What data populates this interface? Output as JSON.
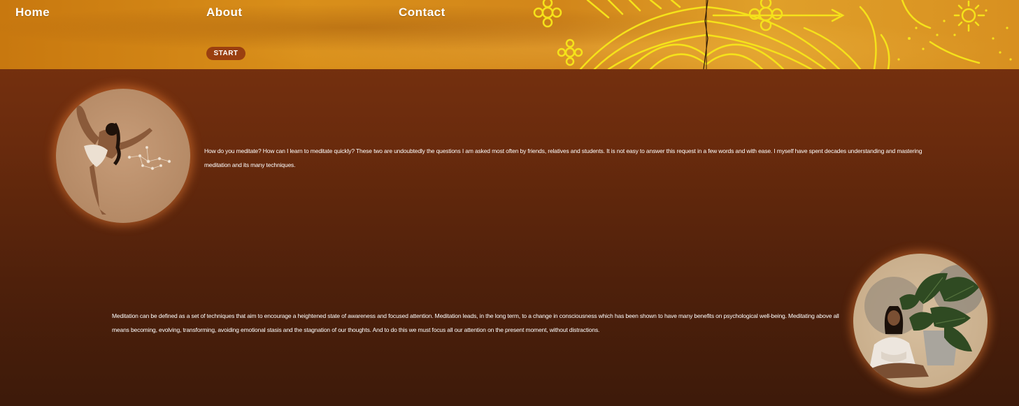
{
  "nav": {
    "home": "Home",
    "about": "About",
    "contact": "Contact"
  },
  "hero": {
    "start_button": "START"
  },
  "sections": [
    {
      "text": "How do you meditate? How can I learn to meditate quickly? These two are undoubtedly the questions I am asked most often by friends, relatives and students. It is not easy to answer this request in a few words and with ease. I myself have spent decades understanding and mastering meditation and its many techniques.",
      "image": "yoga-dancer-pose-illustration"
    },
    {
      "text": "Meditation can be defined as a set of techniques that aim to encourage a heightened state of awareness and focused attention. Meditation leads, in the long term, to a change in consciousness which has been shown to have many benefits on psychological well-being. Meditating above all means becoming, evolving, transforming, avoiding emotional stasis and the stagnation of our thoughts. And to do this we must focus all our attention on the present moment, without distractions.",
      "image": "woman-meditating-with-plant-illustration"
    }
  ],
  "colors": {
    "header_ochre": "#d98f1a",
    "pattern_yellow": "#f5e21a",
    "background_top": "#7d3410",
    "background_bottom": "#3d1a0a",
    "button_bg": "#9a3f10"
  }
}
